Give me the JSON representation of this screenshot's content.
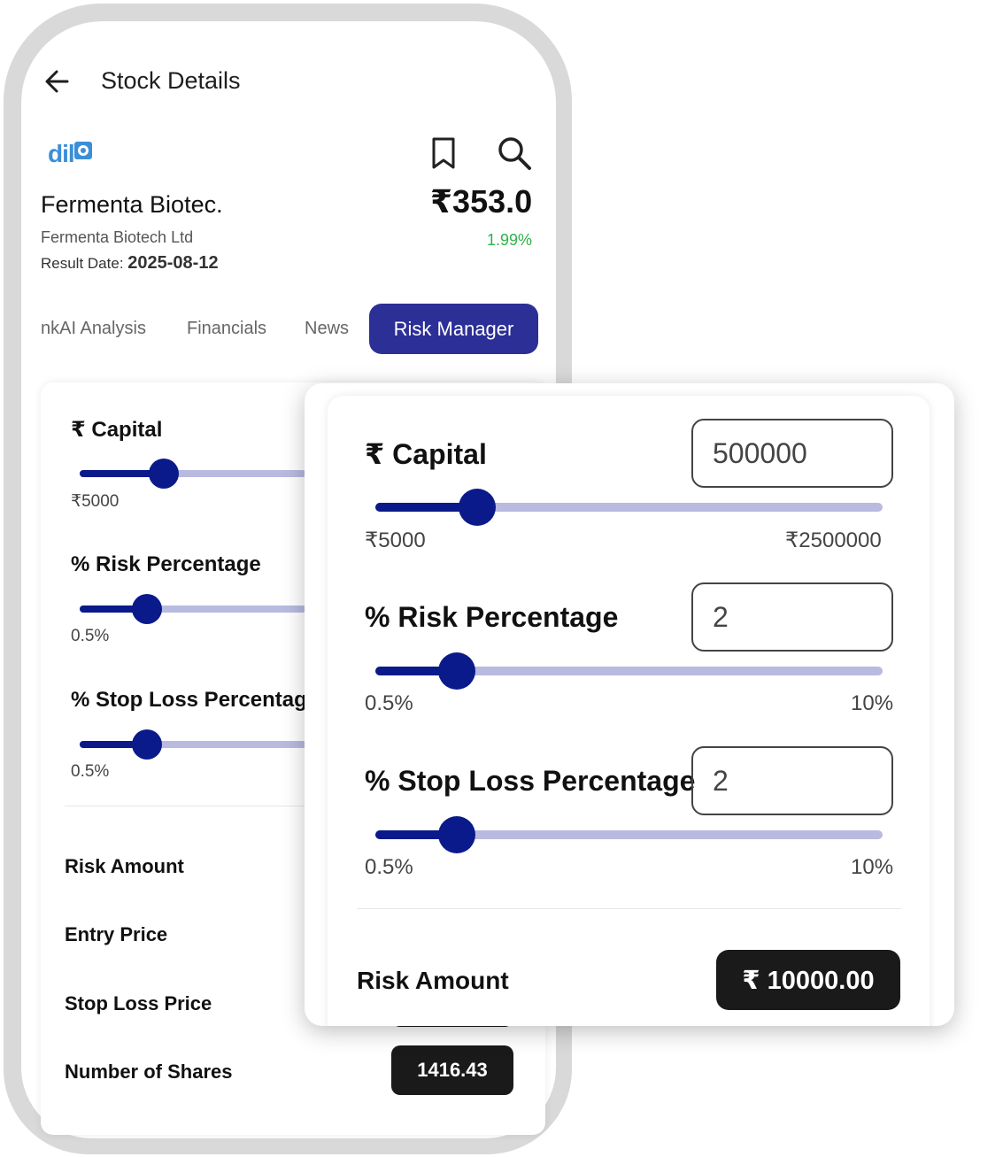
{
  "header": {
    "title": "Stock Details"
  },
  "stock": {
    "name": "Fermenta Biotec.",
    "company": "Fermenta Biotech Ltd",
    "price": "₹353.0",
    "change": "1.99%",
    "result_label": "Result Date:",
    "result_date": "2025-08-12",
    "logo_text": "dil"
  },
  "tabs": [
    "nkAI Analysis",
    "Financials",
    "News",
    "Risk Manager"
  ],
  "active_tab": "Risk Manager",
  "risk_manager": {
    "capital": {
      "label": "₹ Capital",
      "value": "500000",
      "min": "₹5000",
      "max": "₹2500000",
      "position": 0.2
    },
    "risk_percentage": {
      "label": "% Risk Percentage",
      "value": "2",
      "min": "0.5%",
      "max": "10%",
      "position": 0.16
    },
    "stop_loss_percentage": {
      "label": "% Stop Loss Percentage",
      "label_truncated": "% Stop Loss Percentag",
      "value": "2",
      "min": "0.5%",
      "max": "10%",
      "position": 0.16
    },
    "results": {
      "risk_amount": {
        "label": "Risk Amount",
        "value": "₹ 10000.00"
      },
      "entry_price": {
        "label": "Entry Price"
      },
      "stop_loss_price": {
        "label": "Stop Loss Price"
      },
      "number_of_shares": {
        "label": "Number of Shares",
        "value": "1416.43"
      }
    }
  },
  "colors": {
    "accent": "#2b2f96",
    "slider": "#0a1a8a",
    "slider_track": "#b8badf",
    "positive": "#2fb34a",
    "pill": "#1a1a1a"
  }
}
